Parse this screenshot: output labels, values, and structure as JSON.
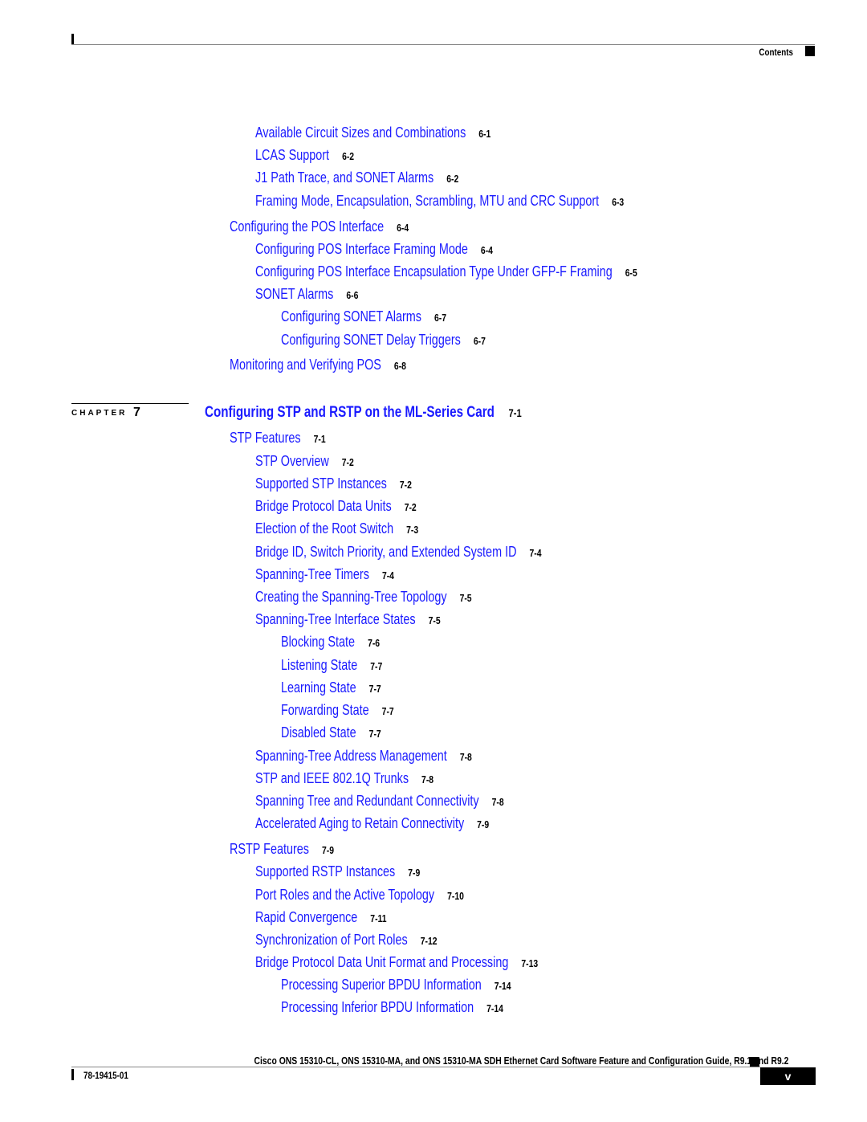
{
  "header": {
    "section_label": "Contents"
  },
  "entries_before": [
    {
      "level": 2,
      "title": "Available Circuit Sizes and Combinations",
      "page": "6-1"
    },
    {
      "level": 2,
      "title": "LCAS Support",
      "page": "6-2"
    },
    {
      "level": 2,
      "title": "J1 Path Trace, and SONET Alarms",
      "page": "6-2"
    },
    {
      "level": 2,
      "title": "Framing Mode, Encapsulation, Scrambling, MTU and CRC Support",
      "page": "6-3"
    },
    {
      "level": 1,
      "title": "Configuring the POS Interface",
      "page": "6-4"
    },
    {
      "level": 2,
      "title": "Configuring POS Interface Framing Mode",
      "page": "6-4"
    },
    {
      "level": 2,
      "title": "Configuring POS Interface Encapsulation Type Under GFP-F Framing",
      "page": "6-5"
    },
    {
      "level": 2,
      "title": "SONET Alarms",
      "page": "6-6"
    },
    {
      "level": 3,
      "title": "Configuring SONET Alarms",
      "page": "6-7"
    },
    {
      "level": 3,
      "title": "Configuring SONET Delay Triggers",
      "page": "6-7"
    },
    {
      "level": 1,
      "title": "Monitoring and Verifying POS",
      "page": "6-8"
    }
  ],
  "chapter": {
    "label": "CHAPTER",
    "number": "7",
    "title": "Configuring STP and RSTP on the ML-Series Card",
    "page": "7-1"
  },
  "entries_after": [
    {
      "level": 1,
      "title": "STP Features",
      "page": "7-1"
    },
    {
      "level": 2,
      "title": "STP Overview",
      "page": "7-2"
    },
    {
      "level": 2,
      "title": "Supported STP Instances",
      "page": "7-2"
    },
    {
      "level": 2,
      "title": "Bridge Protocol Data Units",
      "page": "7-2"
    },
    {
      "level": 2,
      "title": "Election of the Root Switch",
      "page": "7-3"
    },
    {
      "level": 2,
      "title": "Bridge ID, Switch Priority, and Extended System ID",
      "page": "7-4"
    },
    {
      "level": 2,
      "title": "Spanning-Tree Timers",
      "page": "7-4"
    },
    {
      "level": 2,
      "title": "Creating the Spanning-Tree Topology",
      "page": "7-5"
    },
    {
      "level": 2,
      "title": "Spanning-Tree Interface States",
      "page": "7-5"
    },
    {
      "level": 3,
      "title": "Blocking State",
      "page": "7-6"
    },
    {
      "level": 3,
      "title": "Listening State",
      "page": "7-7"
    },
    {
      "level": 3,
      "title": "Learning State",
      "page": "7-7"
    },
    {
      "level": 3,
      "title": "Forwarding State",
      "page": "7-7"
    },
    {
      "level": 3,
      "title": "Disabled State",
      "page": "7-7"
    },
    {
      "level": 2,
      "title": "Spanning-Tree Address Management",
      "page": "7-8"
    },
    {
      "level": 2,
      "title": "STP and IEEE 802.1Q Trunks",
      "page": "7-8"
    },
    {
      "level": 2,
      "title": "Spanning Tree and Redundant Connectivity",
      "page": "7-8"
    },
    {
      "level": 2,
      "title": "Accelerated Aging to Retain Connectivity",
      "page": "7-9"
    },
    {
      "level": 1,
      "title": "RSTP Features",
      "page": "7-9"
    },
    {
      "level": 2,
      "title": "Supported RSTP Instances",
      "page": "7-9"
    },
    {
      "level": 2,
      "title": "Port Roles and the Active Topology",
      "page": "7-10"
    },
    {
      "level": 2,
      "title": "Rapid Convergence",
      "page": "7-11"
    },
    {
      "level": 2,
      "title": "Synchronization of Port Roles",
      "page": "7-12"
    },
    {
      "level": 2,
      "title": "Bridge Protocol Data Unit Format and Processing",
      "page": "7-13"
    },
    {
      "level": 3,
      "title": "Processing Superior BPDU Information",
      "page": "7-14"
    },
    {
      "level": 3,
      "title": "Processing Inferior BPDU Information",
      "page": "7-14"
    }
  ],
  "footer": {
    "guide_title": "Cisco ONS 15310-CL, ONS 15310-MA, and ONS 15310-MA SDH Ethernet Card Software Feature and Configuration Guide, R9.1 and R9.2",
    "doc_number": "78-19415-01",
    "page_number": "v"
  },
  "colors": {
    "link": "#1a1aff",
    "text": "#000000"
  }
}
